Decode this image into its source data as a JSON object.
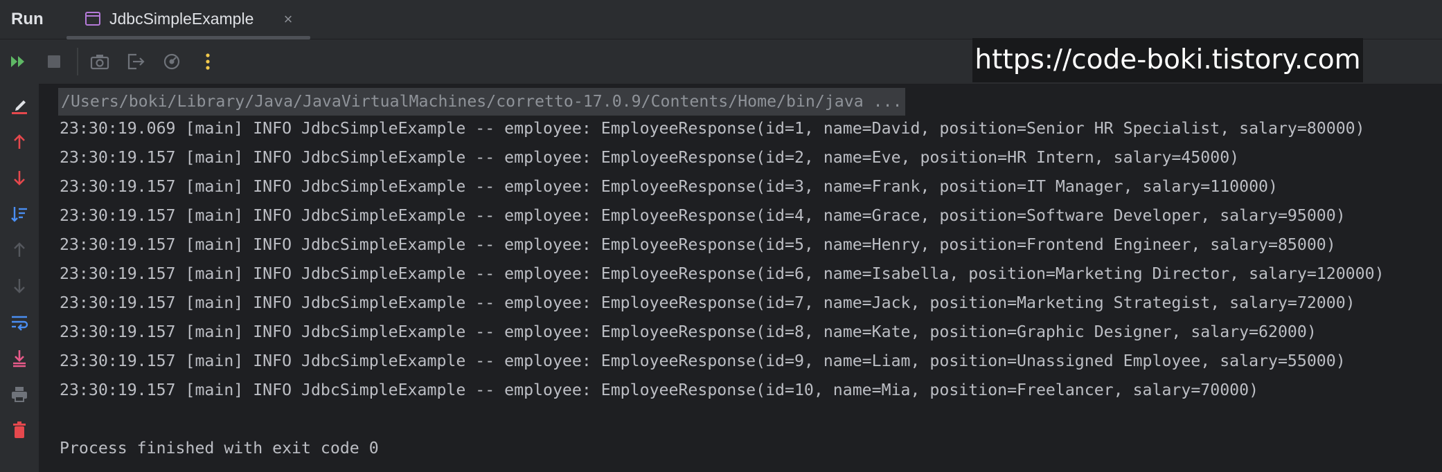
{
  "run_panel": {
    "title": "Run",
    "tab": {
      "label": "JdbcSimpleExample",
      "close": "×"
    }
  },
  "toolbar": {
    "buttons": [
      {
        "name": "rerun-icon",
        "color": "#5fb865"
      },
      {
        "name": "stop-icon",
        "color": "#5a5d63"
      },
      {
        "name": "camera-icon",
        "color": "#6f737a"
      },
      {
        "name": "exit-icon",
        "color": "#6f737a"
      },
      {
        "name": "settings-icon",
        "color": "#6f737a"
      },
      {
        "name": "more-icon",
        "color": "#f2c94c"
      }
    ]
  },
  "watermark": "https://code-boki.tistory.com",
  "gutter": {
    "buttons": [
      "edit-icon",
      "up-arrow-icon",
      "down-arrow-icon",
      "sort-icon",
      "up-arrow-disabled-icon",
      "down-arrow-disabled-icon",
      "soft-wrap-icon",
      "scroll-to-end-icon",
      "print-icon",
      "trash-icon"
    ]
  },
  "console": {
    "command": "/Users/boki/Library/Java/JavaVirtualMachines/corretto-17.0.9/Contents/Home/bin/java ...",
    "lines": [
      "23:30:19.069 [main] INFO JdbcSimpleExample -- employee: EmployeeResponse(id=1, name=David, position=Senior HR Specialist, salary=80000)",
      "23:30:19.157 [main] INFO JdbcSimpleExample -- employee: EmployeeResponse(id=2, name=Eve, position=HR Intern, salary=45000)",
      "23:30:19.157 [main] INFO JdbcSimpleExample -- employee: EmployeeResponse(id=3, name=Frank, position=IT Manager, salary=110000)",
      "23:30:19.157 [main] INFO JdbcSimpleExample -- employee: EmployeeResponse(id=4, name=Grace, position=Software Developer, salary=95000)",
      "23:30:19.157 [main] INFO JdbcSimpleExample -- employee: EmployeeResponse(id=5, name=Henry, position=Frontend Engineer, salary=85000)",
      "23:30:19.157 [main] INFO JdbcSimpleExample -- employee: EmployeeResponse(id=6, name=Isabella, position=Marketing Director, salary=120000)",
      "23:30:19.157 [main] INFO JdbcSimpleExample -- employee: EmployeeResponse(id=7, name=Jack, position=Marketing Strategist, salary=72000)",
      "23:30:19.157 [main] INFO JdbcSimpleExample -- employee: EmployeeResponse(id=8, name=Kate, position=Graphic Designer, salary=62000)",
      "23:30:19.157 [main] INFO JdbcSimpleExample -- employee: EmployeeResponse(id=9, name=Liam, position=Unassigned Employee, salary=55000)",
      "23:30:19.157 [main] INFO JdbcSimpleExample -- employee: EmployeeResponse(id=10, name=Mia, position=Freelancer, salary=70000)"
    ],
    "exit_message": "Process finished with exit code 0"
  }
}
